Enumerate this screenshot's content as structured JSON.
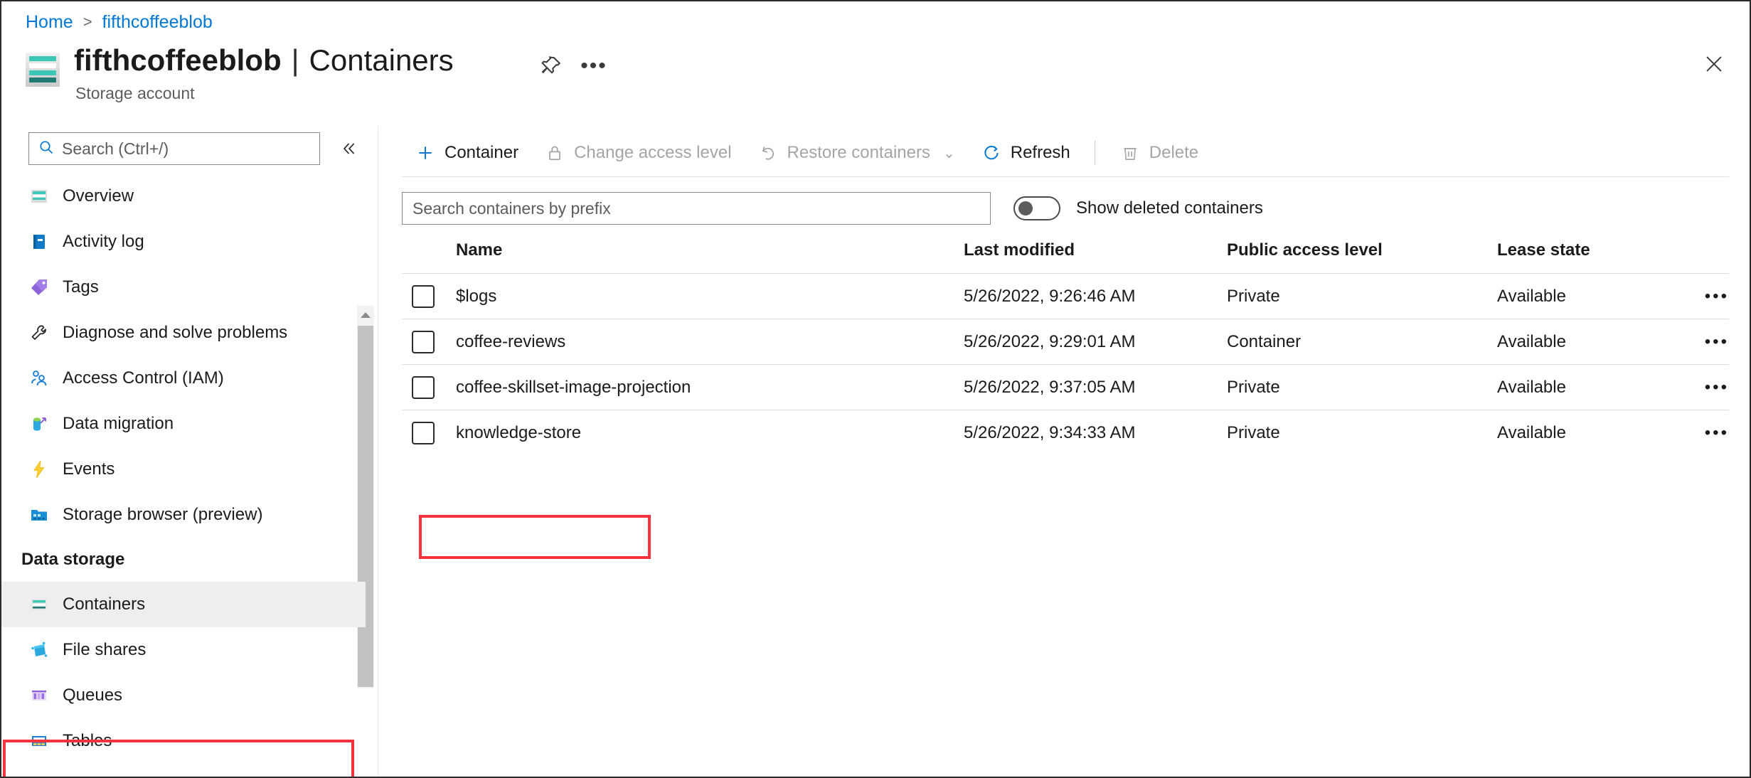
{
  "breadcrumb": {
    "home": "Home",
    "separator": ">",
    "current": "fifthcoffeeblob"
  },
  "header": {
    "resource_name": "fifthcoffeeblob",
    "pipe": "|",
    "page_name": "Containers",
    "subtitle": "Storage account",
    "pin_icon": "pin-icon",
    "more_icon": "ellipsis-icon",
    "close_icon": "close-icon"
  },
  "sidebar": {
    "search_placeholder": "Search (Ctrl+/)",
    "search_value": "",
    "collapse_icon": "chevron-double-left-icon",
    "items": [
      {
        "label": "Overview",
        "icon": "storage-account-icon",
        "selected": false
      },
      {
        "label": "Activity log",
        "icon": "activity-log-icon",
        "selected": false
      },
      {
        "label": "Tags",
        "icon": "tag-icon",
        "selected": false
      },
      {
        "label": "Diagnose and solve problems",
        "icon": "wrench-icon",
        "selected": false
      },
      {
        "label": "Access Control (IAM)",
        "icon": "people-icon",
        "selected": false
      },
      {
        "label": "Data migration",
        "icon": "data-migration-icon",
        "selected": false
      },
      {
        "label": "Events",
        "icon": "lightning-icon",
        "selected": false
      },
      {
        "label": "Storage browser (preview)",
        "icon": "storage-browser-icon",
        "selected": false
      }
    ],
    "group_title": "Data storage",
    "group_items": [
      {
        "label": "Containers",
        "icon": "containers-icon",
        "selected": true
      },
      {
        "label": "File shares",
        "icon": "file-shares-icon",
        "selected": false
      },
      {
        "label": "Queues",
        "icon": "queues-icon",
        "selected": false
      },
      {
        "label": "Tables",
        "icon": "tables-icon",
        "selected": false
      }
    ]
  },
  "toolbar": {
    "add_container": {
      "label": "Container",
      "icon": "plus-icon",
      "disabled": false
    },
    "change_access": {
      "label": "Change access level",
      "icon": "lock-icon",
      "disabled": true
    },
    "restore": {
      "label": "Restore containers",
      "icon": "undo-icon",
      "caret": "chevron-down-icon",
      "disabled": true
    },
    "refresh": {
      "label": "Refresh",
      "icon": "refresh-icon",
      "disabled": false
    },
    "delete": {
      "label": "Delete",
      "icon": "trash-icon",
      "disabled": true
    }
  },
  "filters": {
    "search_placeholder": "Search containers by prefix",
    "search_value": "",
    "toggle_label": "Show deleted containers",
    "toggle_on": false
  },
  "table": {
    "columns": [
      "Name",
      "Last modified",
      "Public access level",
      "Lease state"
    ],
    "rows": [
      {
        "name": "$logs",
        "modified": "5/26/2022, 9:26:46 AM",
        "access": "Private",
        "lease": "Available",
        "menu": "row-menu-icon"
      },
      {
        "name": "coffee-reviews",
        "modified": "5/26/2022, 9:29:01 AM",
        "access": "Container",
        "lease": "Available",
        "menu": "row-menu-icon"
      },
      {
        "name": "coffee-skillset-image-projection",
        "modified": "5/26/2022, 9:37:05 AM",
        "access": "Private",
        "lease": "Available",
        "menu": "row-menu-icon"
      },
      {
        "name": "knowledge-store",
        "modified": "5/26/2022, 9:34:33 AM",
        "access": "Private",
        "lease": "Available",
        "menu": "row-menu-icon"
      }
    ]
  },
  "annotations": {
    "highlight_color": "#f5333f",
    "highlighted_sidebar_item": "Containers",
    "highlighted_row": "knowledge-store"
  },
  "colors": {
    "link": "#0078d4",
    "accent_teal": "#3dc7b6",
    "text": "#1b1b1b",
    "disabled": "#a5a5a5"
  }
}
